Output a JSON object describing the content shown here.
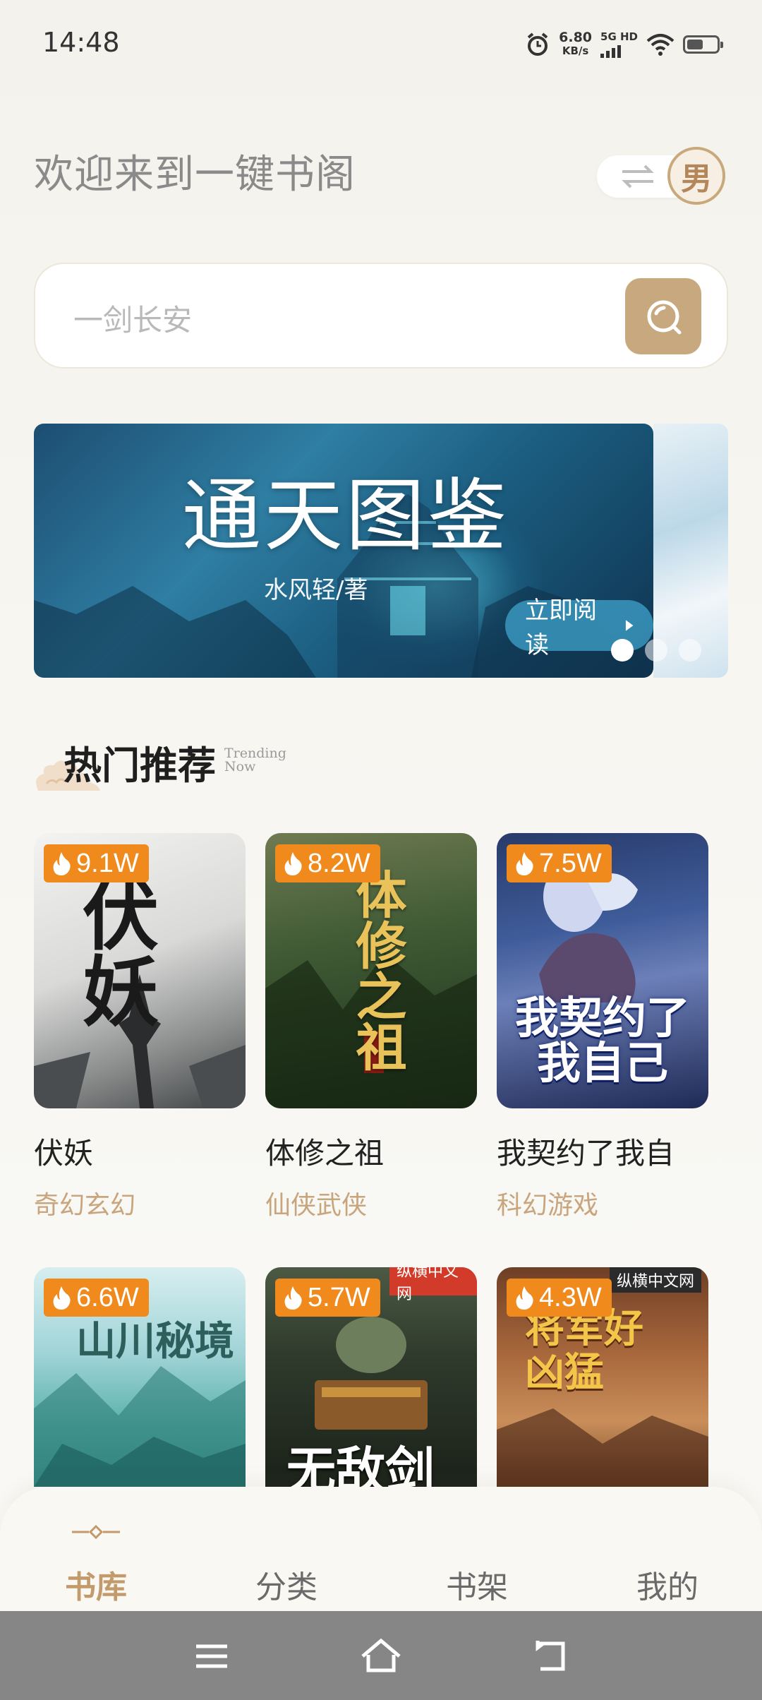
{
  "status_bar": {
    "time": "14:48",
    "net_speed": "6.80",
    "net_unit": "KB/s",
    "network": "5G HD"
  },
  "header": {
    "welcome": "欢迎来到一键书阁",
    "gender_label": "男"
  },
  "search": {
    "placeholder": "一剑长安"
  },
  "banner": {
    "title": "通天图鉴",
    "author": "水风轻/著",
    "read_button": "立即阅读",
    "page_index": 1,
    "page_count": 3
  },
  "section": {
    "title": "热门推荐",
    "subtitle_line1": "Trending",
    "subtitle_line2": "Now"
  },
  "books": [
    {
      "heat": "9.1W",
      "name": "伏妖",
      "category": "奇幻玄幻",
      "cover_text": "伏妖"
    },
    {
      "heat": "8.2W",
      "name": "体修之祖",
      "category": "仙侠武侠",
      "cover_text": "体修之祖"
    },
    {
      "heat": "7.5W",
      "name": "我契约了我自",
      "category": "科幻游戏",
      "cover_text": "我契约了我自己"
    },
    {
      "heat": "6.6W",
      "name": "",
      "category": "",
      "cover_text": "山川秘境"
    },
    {
      "heat": "5.7W",
      "name": "",
      "category": "",
      "cover_text": "无敌剑尊"
    },
    {
      "heat": "4.3W",
      "name": "",
      "category": "",
      "cover_text": "将军好凶猛"
    }
  ],
  "cover_publishers": [
    "纵横中文网",
    "纵横中文网"
  ],
  "tabs": [
    {
      "label": "书库",
      "active": true
    },
    {
      "label": "分类",
      "active": false
    },
    {
      "label": "书架",
      "active": false
    },
    {
      "label": "我的",
      "active": false
    }
  ],
  "colors": {
    "accent": "#c8a87e",
    "badge": "#f08a1c",
    "category_text": "#c9a57e"
  },
  "icons": {
    "search": "search-icon",
    "swap": "swap-icon",
    "flame": "flame-icon",
    "menu": "menu-icon",
    "home": "home-icon",
    "back": "back-icon"
  }
}
